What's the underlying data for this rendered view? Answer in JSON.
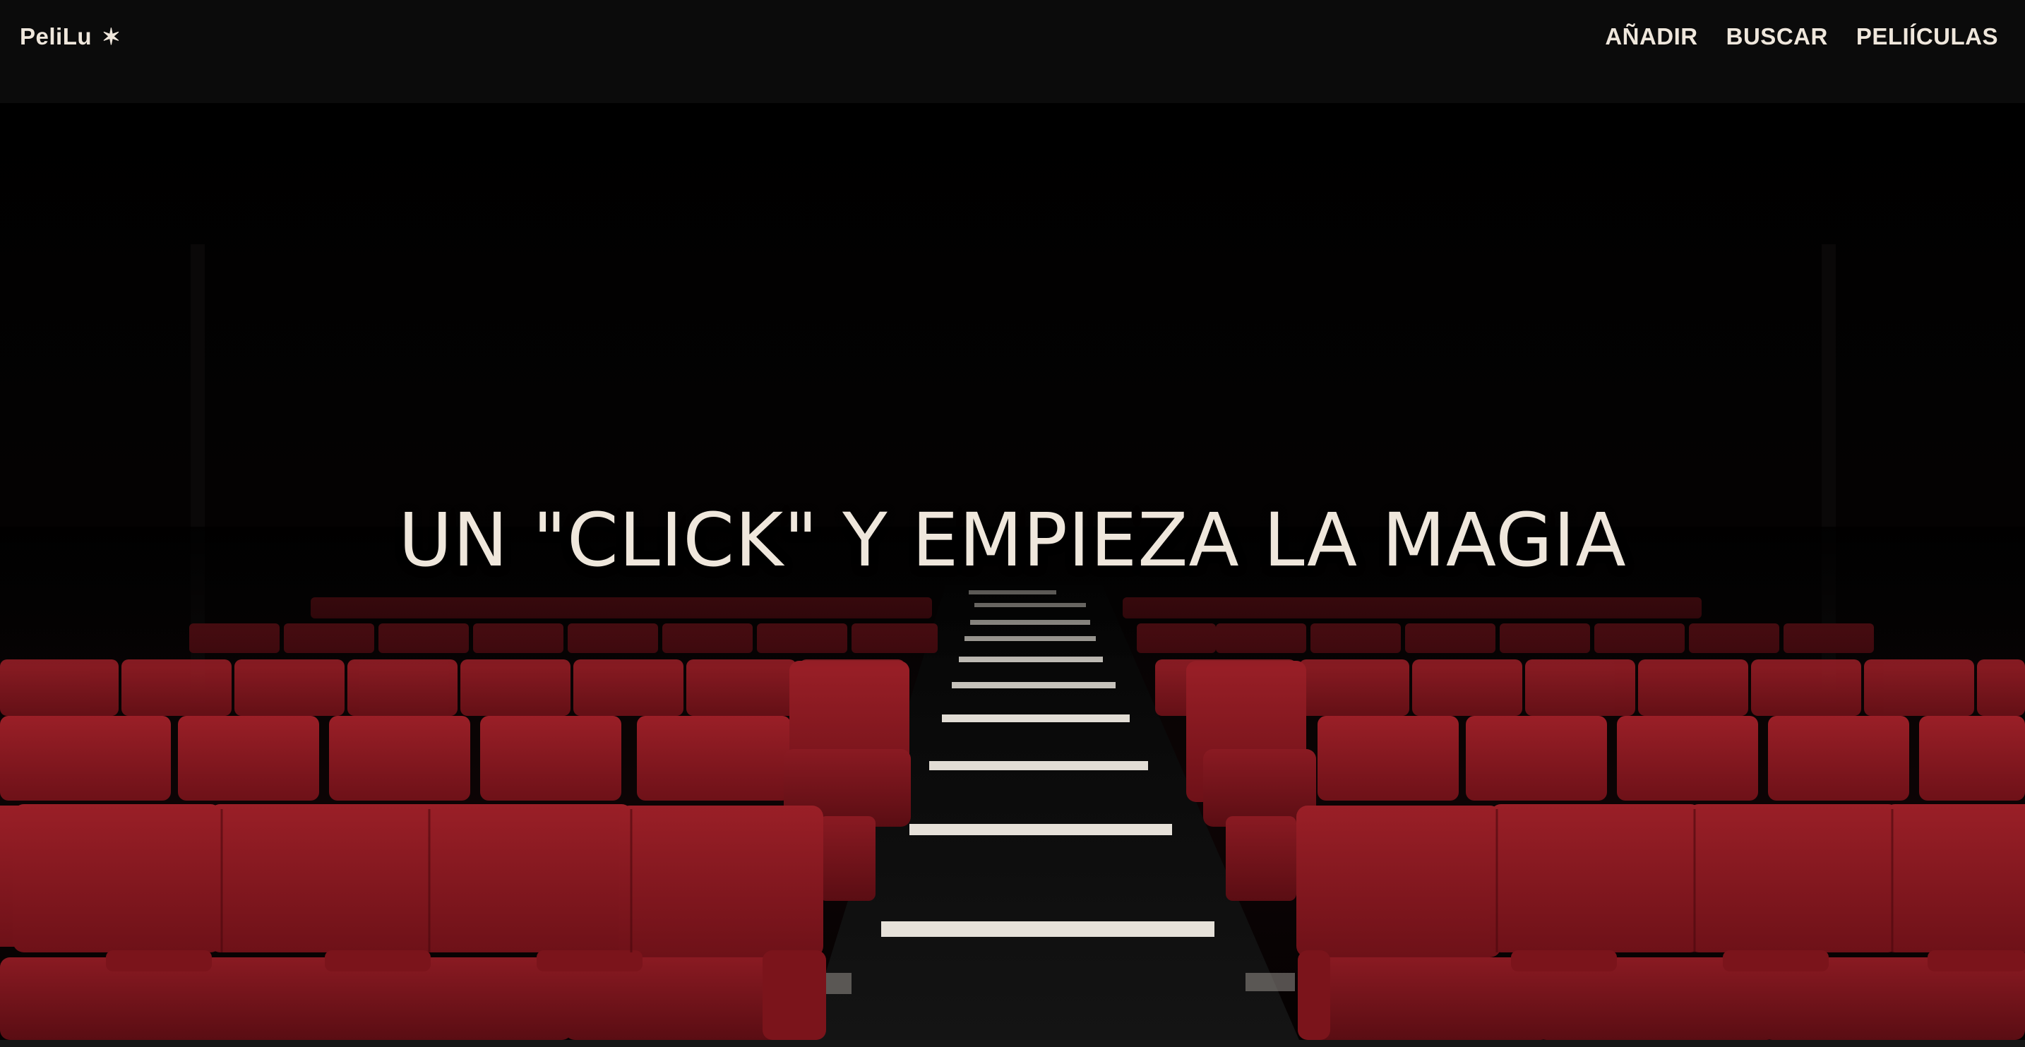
{
  "navbar": {
    "brand": "PeliLu",
    "brand_icon": "star-icon",
    "links": [
      "AÑADIR",
      "BUSCAR",
      "PELIÍCULAS"
    ]
  },
  "hero": {
    "title": "UN \"CLICK\" Y EMPIEZA LA MAGIA",
    "background": "cinema-seats-image"
  },
  "colors": {
    "navbar_bg": "#0b0b0b",
    "text": "#efe7dc",
    "seat_red": "#8e1a22",
    "background": "#000000"
  }
}
